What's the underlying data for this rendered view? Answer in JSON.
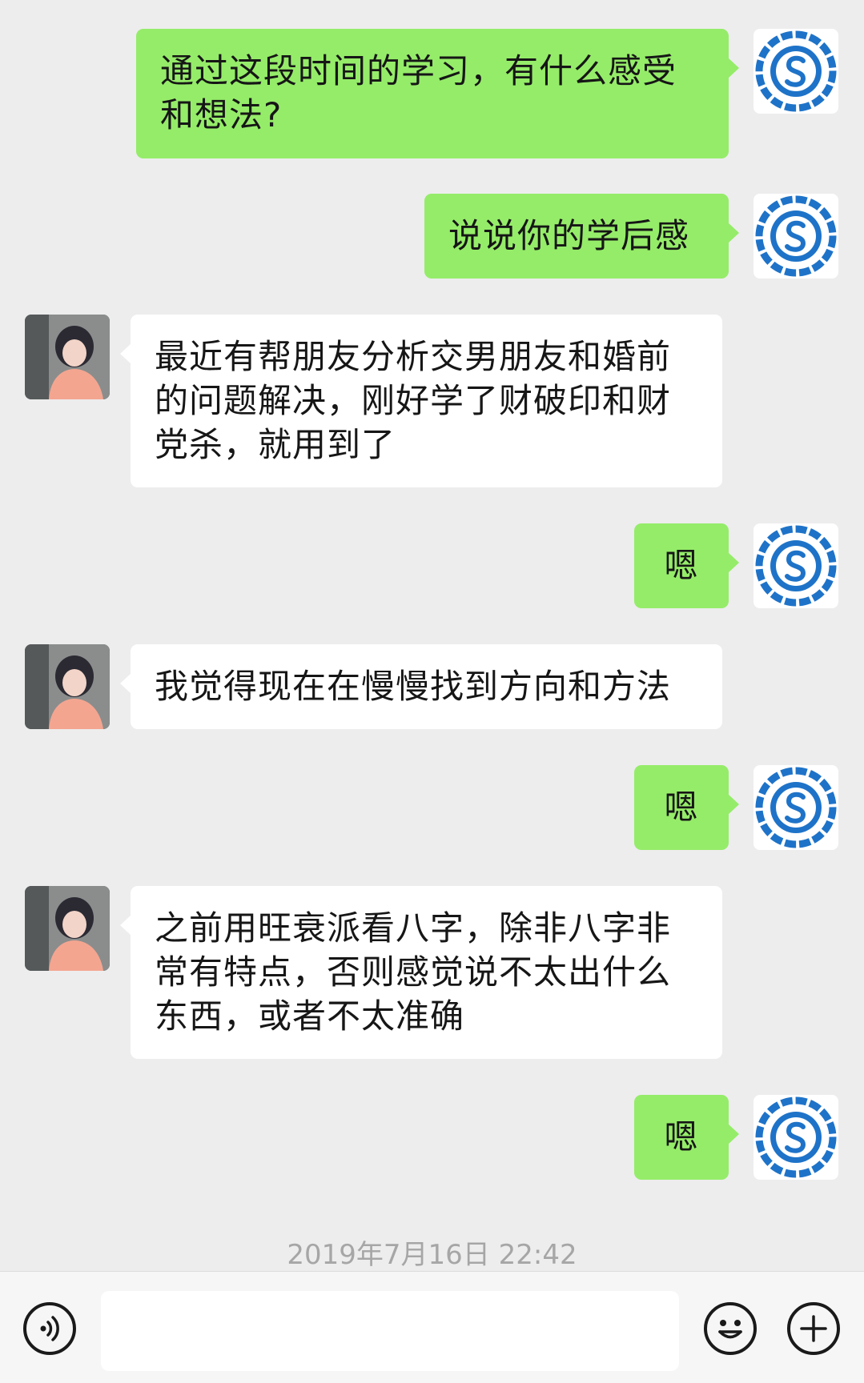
{
  "messages": [
    {
      "side": "me",
      "text": "通过这段时间的学习，有什么感受\n和想法?"
    },
    {
      "side": "me",
      "text": "说说你的学后感"
    },
    {
      "side": "other",
      "text": "最近有帮朋友分析交男朋友和婚前\n的问题解决，刚好学了财破印和财\n党杀，就用到了"
    },
    {
      "side": "me",
      "text": "嗯"
    },
    {
      "side": "other",
      "text": "我觉得现在在慢慢找到方向和方法"
    },
    {
      "side": "me",
      "text": "嗯"
    },
    {
      "side": "other",
      "text": "之前用旺衰派看八字，除非八字非\n常有特点，否则感觉说不太出什么\n东西，或者不太准确"
    },
    {
      "side": "me",
      "text": "嗯"
    }
  ],
  "timestamp": "2019年7月16日 22:42",
  "input": {
    "placeholder": "",
    "value": ""
  },
  "icons": {
    "voice": "voice-icon",
    "emoji": "emoji-icon",
    "plus": "plus-icon"
  },
  "colors": {
    "my_bubble": "#95ec69",
    "other_bubble": "#ffffff",
    "background": "#ededed",
    "logo_blue": "#1e73c8"
  }
}
